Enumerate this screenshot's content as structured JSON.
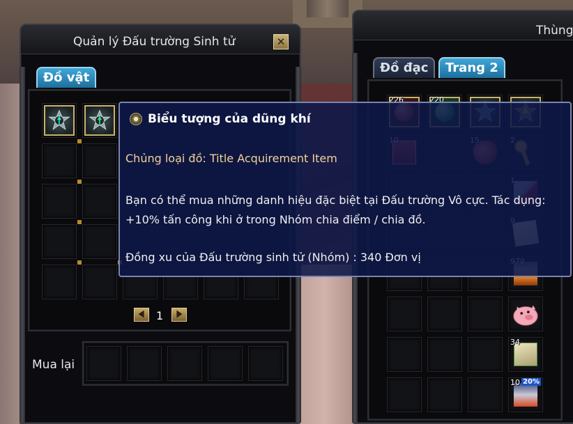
{
  "arena_panel": {
    "title": "Quản lý Đấu trường Sinh tử",
    "close_symbol": "✕",
    "tab_label": "Đồ vật",
    "page_number": "1",
    "buyback_label": "Mua lại"
  },
  "inventory_panel": {
    "title": "Thùng",
    "tabs": [
      {
        "label": "Đồ đạc",
        "active": false
      },
      {
        "label": "Trang 2",
        "active": true
      }
    ],
    "slots": [
      {
        "qty": "226",
        "icon": "red-coin-icon"
      },
      {
        "qty": "220",
        "icon": "green-coin-icon"
      },
      {
        "qty": "",
        "icon": "rank-insignia-icon"
      },
      {
        "qty": "",
        "icon": "gold-emblem-icon"
      },
      {
        "qty": "10",
        "icon": "red-chest-icon"
      },
      {
        "qty": "15",
        "icon": "red-pouch-icon"
      },
      {
        "qty": "2",
        "icon": "key-icon"
      },
      {
        "qty": "1",
        "icon": "scroll-sword-icon"
      },
      {
        "qty": "9",
        "icon": "paper-icon"
      },
      {
        "qty": "979",
        "icon": "hammer-icon"
      },
      {
        "qty": "",
        "icon": "pig-icon"
      },
      {
        "qty": "34",
        "icon": "spellbook-icon"
      },
      {
        "qty": "10",
        "badge": "20%",
        "icon": "armor-icon"
      }
    ]
  },
  "tooltip": {
    "title": "Biểu tượng của dũng khí",
    "type_line": "Chủng loại đồ: Title Acquirement Item",
    "description": "Bạn có thể mua những danh hiệu đặc biệt tại Đấu trường Vô cực. Tác dụng: +10% tấn công khi ở trong Nhóm chia điểm / chia đồ.",
    "cost_line": "Đồng xu của Đấu trường sinh tử (Nhóm) : 340 Đơn vị"
  },
  "colors": {
    "tooltip_bg": "#0e1848",
    "tooltip_border": "#7a85b5",
    "tab_active": "#2a8cc0",
    "type_text": "#f3d19a",
    "gold_frame": "#c9b26a"
  }
}
